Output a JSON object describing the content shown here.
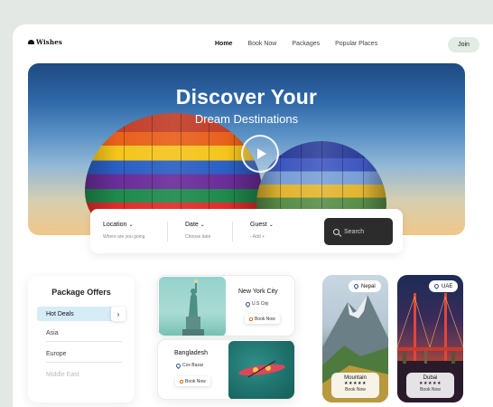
{
  "brand": {
    "name": "Wishes"
  },
  "nav": {
    "items": [
      "Home",
      "Book Now",
      "Packages",
      "Popular Places"
    ],
    "active": "Home",
    "join_label": "Join"
  },
  "hero": {
    "title": "Discover Your",
    "subtitle": "Dream Destinations"
  },
  "search": {
    "location_label": "Location",
    "location_hint": "Where are you going",
    "date_label": "Date",
    "date_hint": "Choose date",
    "guest_label": "Guest",
    "guest_hint": "- Add +",
    "button_label": "Search"
  },
  "offers": {
    "title": "Package Offers",
    "items": [
      "Hot Deals",
      "Asia",
      "Europe",
      "Middle East"
    ],
    "selected": "Hot Deals"
  },
  "cards": [
    {
      "name": "New York City",
      "location": "U.S City",
      "button": "Book Now"
    },
    {
      "name": "Bangladesh",
      "location": "Cox Bazar",
      "button": "Book Now"
    }
  ],
  "destinations": [
    {
      "tag": "Nepal",
      "name": "Mountain",
      "stars": "★★★★★",
      "button": "Book Now"
    },
    {
      "tag": "UAE",
      "name": "Dubai",
      "stars": "★★★★★",
      "button": "Book Now"
    }
  ],
  "colors": {
    "accent_bg": "#d6ecf7",
    "dark_button": "#2c2c2c",
    "join_bg": "#e2ece4",
    "page_bg": "#e3e8e4"
  }
}
